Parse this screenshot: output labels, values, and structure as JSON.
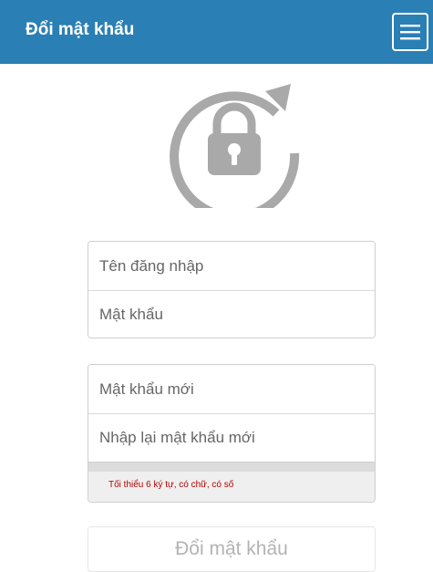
{
  "header": {
    "title": "Đổi mật khẩu",
    "menu_icon": "hamburger-menu-icon",
    "background_color": "#2a7fb4"
  },
  "hero": {
    "icon": "lock-reset-icon",
    "icon_color": "#a9a9a9"
  },
  "login_form": {
    "username_placeholder": "Tên đăng nhập",
    "password_placeholder": "Mật khẩu"
  },
  "new_password_form": {
    "new_password_placeholder": "Mật khẩu mới",
    "confirm_password_placeholder": "Nhập lại mật khẩu mới",
    "hint": "Tối thiểu 6 ký tự, có chữ, có số",
    "hint_color": "#b30000"
  },
  "submit": {
    "label": "Đổi mật khẩu"
  }
}
